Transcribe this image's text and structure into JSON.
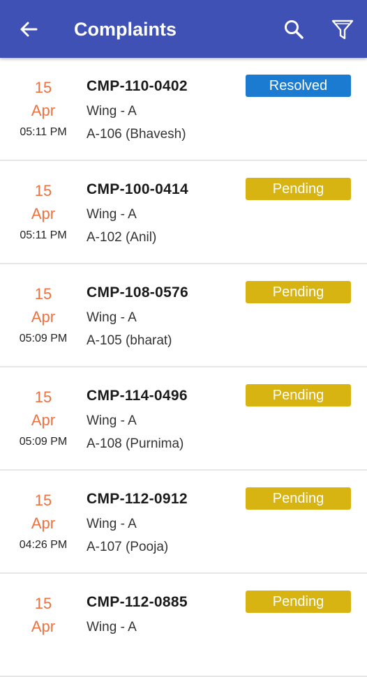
{
  "header": {
    "title": "Complaints",
    "back_icon": "arrow-back-icon",
    "search_icon": "search-icon",
    "filter_icon": "filter-icon",
    "bg_color": "#3f51b5"
  },
  "status_colors": {
    "Resolved": "#1a7bd0",
    "Pending": "#d8b412"
  },
  "complaints": [
    {
      "day": "15",
      "month": "Apr",
      "time": "05:11 PM",
      "code": "CMP-110-0402",
      "wing": "Wing - A",
      "unit": "A-106 (Bhavesh)",
      "status": "Resolved"
    },
    {
      "day": "15",
      "month": "Apr",
      "time": "05:11 PM",
      "code": "CMP-100-0414",
      "wing": "Wing - A",
      "unit": "A-102 (Anil)",
      "status": "Pending"
    },
    {
      "day": "15",
      "month": "Apr",
      "time": "05:09 PM",
      "code": "CMP-108-0576",
      "wing": "Wing - A",
      "unit": "A-105 (bharat)",
      "status": "Pending"
    },
    {
      "day": "15",
      "month": "Apr",
      "time": "05:09 PM",
      "code": "CMP-114-0496",
      "wing": "Wing - A",
      "unit": "A-108 (Purnima)",
      "status": "Pending"
    },
    {
      "day": "15",
      "month": "Apr",
      "time": "04:26 PM",
      "code": "CMP-112-0912",
      "wing": "Wing - A",
      "unit": "A-107 (Pooja)",
      "status": "Pending"
    },
    {
      "day": "15",
      "month": "Apr",
      "time": "",
      "code": "CMP-112-0885",
      "wing": "Wing - A",
      "unit": "",
      "status": "Pending"
    }
  ]
}
